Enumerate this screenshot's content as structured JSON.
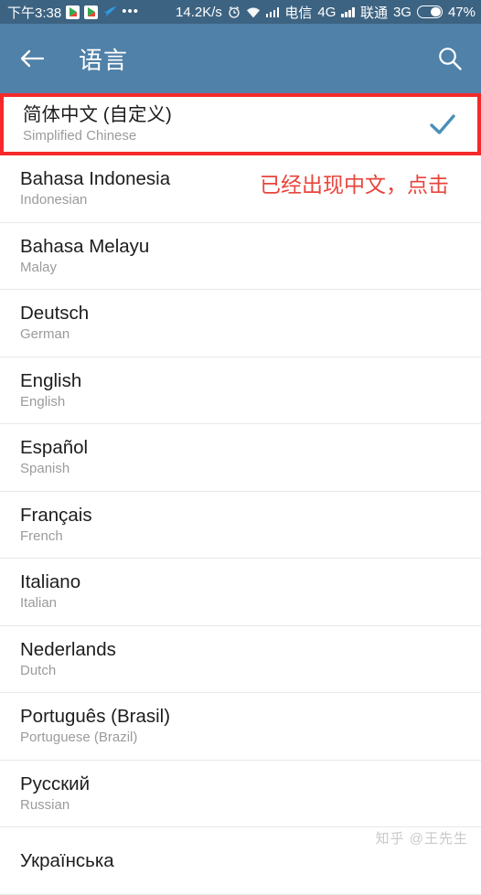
{
  "statusbar": {
    "clock": "下午3:38",
    "icons_left": [
      "play-store-icon",
      "play-store-icon",
      "bird-icon",
      "more-dots-icon"
    ],
    "network_speed": "14.2K/s",
    "alarm": "alarm-icon",
    "wifi": "wifi-icon",
    "sim1_signal": "signal-bars-icon",
    "sim1_carrier": "电信",
    "sim1_network": "4G",
    "sim2_signal": "signal-bars-icon",
    "sim2_carrier": "联通",
    "sim2_network": "3G",
    "battery_icon": "battery-icon",
    "battery_percent": "47%"
  },
  "appbar": {
    "back": "back-arrow-icon",
    "title": "语言",
    "search": "search-icon",
    "bg_color": "#5081a8"
  },
  "annotation": {
    "text": "已经出现中文，点击",
    "color": "#e8453c"
  },
  "watermark": {
    "text": "知乎 @王先生"
  },
  "selected": {
    "primary": "简体中文 (自定义)",
    "secondary": "Simplified Chinese",
    "check_icon": "check-icon",
    "check_color": "#4a90b8",
    "highlight_color": "#f5292b"
  },
  "languages": [
    {
      "primary": "Bahasa Indonesia",
      "secondary": "Indonesian"
    },
    {
      "primary": "Bahasa Melayu",
      "secondary": "Malay"
    },
    {
      "primary": "Deutsch",
      "secondary": "German"
    },
    {
      "primary": "English",
      "secondary": "English"
    },
    {
      "primary": "Español",
      "secondary": "Spanish"
    },
    {
      "primary": "Français",
      "secondary": "French"
    },
    {
      "primary": "Italiano",
      "secondary": "Italian"
    },
    {
      "primary": "Nederlands",
      "secondary": "Dutch"
    },
    {
      "primary": "Português (Brasil)",
      "secondary": "Portuguese (Brazil)"
    },
    {
      "primary": "Русский",
      "secondary": "Russian"
    },
    {
      "primary": "Українська",
      "secondary": ""
    }
  ]
}
